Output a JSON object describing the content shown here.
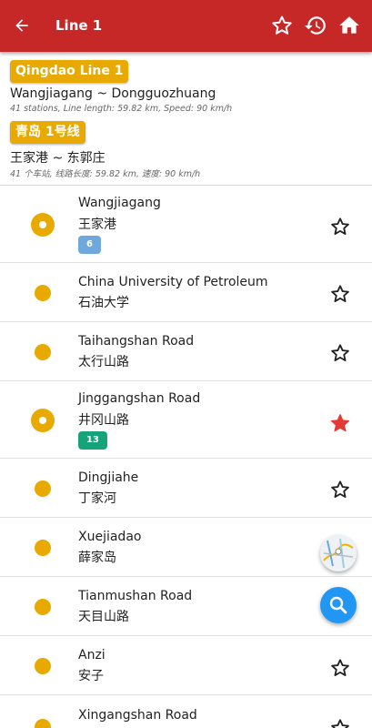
{
  "appbar": {
    "title": "Line 1",
    "back_icon": "arrow-left-icon",
    "actions": [
      "star-outline-icon",
      "history-icon",
      "home-icon"
    ]
  },
  "line_info": {
    "name_en": "Qingdao Line 1",
    "route_en": "Wangjiagang ~ Dongguozhuang",
    "meta_en": "41 stations, Line length: 59.82 km, Speed: 90 km/h",
    "name_cn": "青岛 1号线",
    "route_cn": "王家港 ~ 东郭庄",
    "meta_cn": "41 个车站, 线路长度: 59.82 km, 速度: 90 km/h"
  },
  "colors": {
    "appbar": "#c62828",
    "line": "#e8a900",
    "fav_active": "#e53935",
    "fab_search": "#2196f3"
  },
  "stations": [
    {
      "en": "Wangjiagang",
      "cn": "王家港",
      "transfer": "6",
      "transfer_color": "#6fa8dc",
      "favorite": false
    },
    {
      "en": "China University of Petroleum",
      "cn": "石油大学",
      "favorite": false
    },
    {
      "en": "Taihangshan Road",
      "cn": "太行山路",
      "favorite": false
    },
    {
      "en": "Jinggangshan Road",
      "cn": "井冈山路",
      "transfer": "13",
      "transfer_color": "#16a37a",
      "favorite": true
    },
    {
      "en": "Dingjiahe",
      "cn": "丁家河",
      "favorite": false
    },
    {
      "en": "Xuejiadao",
      "cn": "薛家岛",
      "favorite": false
    },
    {
      "en": "Tianmushan Road",
      "cn": "天目山路",
      "favorite": false
    },
    {
      "en": "Anzi",
      "cn": "安子",
      "favorite": false
    },
    {
      "en": "Xingangshan Road",
      "cn": "",
      "favorite": false
    }
  ],
  "fabs": [
    "metro-map-icon",
    "search-icon"
  ]
}
